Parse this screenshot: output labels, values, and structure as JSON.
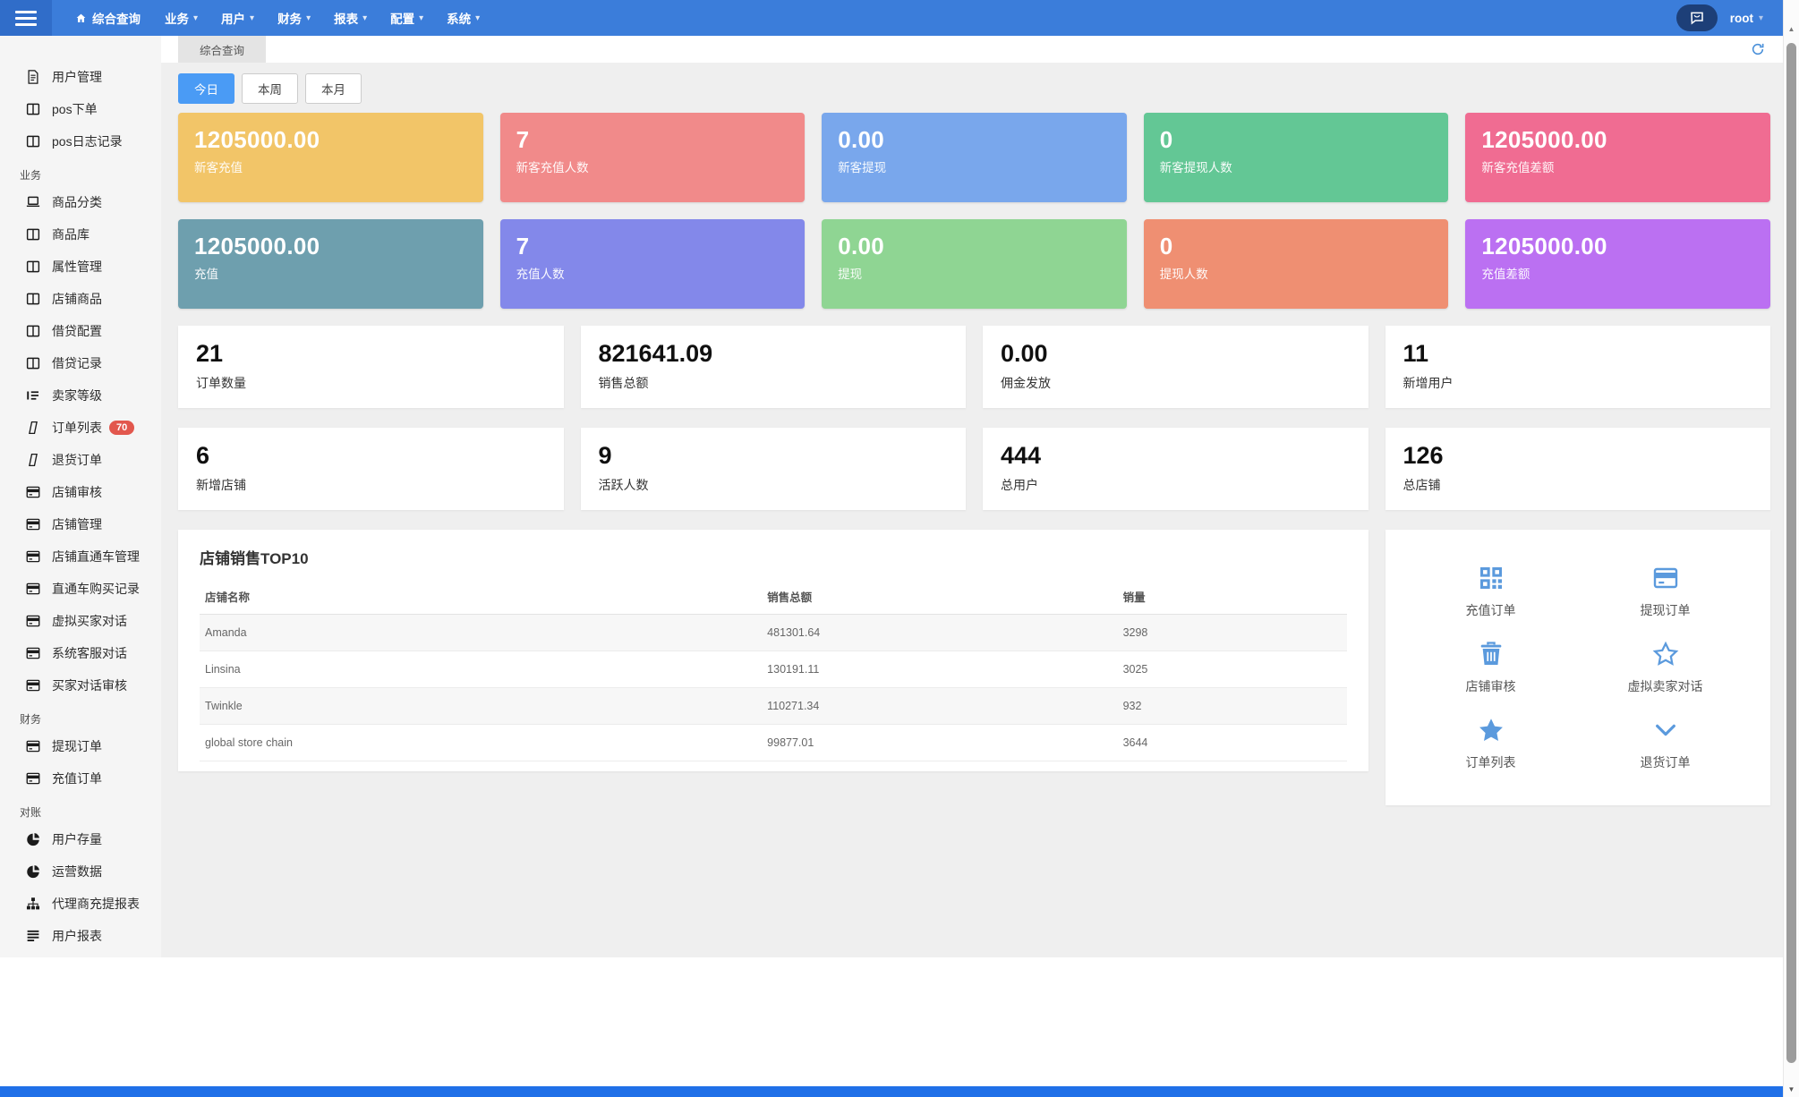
{
  "navbar": {
    "brand": "综合查询",
    "menus": [
      "业务",
      "用户",
      "财务",
      "报表",
      "配置",
      "系统"
    ],
    "user": "root"
  },
  "tabbar": {
    "active_tab": "综合查询"
  },
  "filters": {
    "today": "今日",
    "week": "本周",
    "month": "本月"
  },
  "sidebar": {
    "sections": [
      {
        "header": "",
        "items": [
          {
            "icon": "file-text",
            "label": "用户管理"
          },
          {
            "icon": "columns",
            "label": "pos下单"
          },
          {
            "icon": "columns",
            "label": "pos日志记录"
          }
        ]
      },
      {
        "header": "业务",
        "items": [
          {
            "icon": "laptop",
            "label": "商品分类"
          },
          {
            "icon": "columns",
            "label": "商品库"
          },
          {
            "icon": "columns",
            "label": "属性管理"
          },
          {
            "icon": "columns",
            "label": "店铺商品"
          },
          {
            "icon": "columns",
            "label": "借贷配置"
          },
          {
            "icon": "columns",
            "label": "借贷记录"
          },
          {
            "icon": "list",
            "label": "卖家等级"
          },
          {
            "icon": "order",
            "label": "订单列表",
            "badge": "70"
          },
          {
            "icon": "order",
            "label": "退货订单"
          },
          {
            "icon": "credit-card",
            "label": "店铺审核"
          },
          {
            "icon": "credit-card",
            "label": "店铺管理"
          },
          {
            "icon": "credit-card",
            "label": "店铺直通车管理"
          },
          {
            "icon": "credit-card",
            "label": "直通车购买记录"
          },
          {
            "icon": "credit-card",
            "label": "虚拟买家对话"
          },
          {
            "icon": "credit-card",
            "label": "系统客服对话"
          },
          {
            "icon": "credit-card",
            "label": "买家对话审核"
          }
        ]
      },
      {
        "header": "财务",
        "items": [
          {
            "icon": "credit-card",
            "label": "提现订单"
          },
          {
            "icon": "credit-card",
            "label": "充值订单"
          }
        ]
      },
      {
        "header": "对账",
        "items": [
          {
            "icon": "pie-chart",
            "label": "用户存量"
          },
          {
            "icon": "pie-chart",
            "label": "运营数据"
          },
          {
            "icon": "sitemap",
            "label": "代理商充提报表"
          },
          {
            "icon": "lines",
            "label": "用户报表"
          }
        ]
      }
    ]
  },
  "stat_cards": {
    "row1": [
      {
        "value": "1205000.00",
        "label": "新客充值",
        "color": "#f2c568"
      },
      {
        "value": "7",
        "label": "新客充值人数",
        "color": "#f18a8a"
      },
      {
        "value": "0.00",
        "label": "新客提现",
        "color": "#79a7ec"
      },
      {
        "value": "0",
        "label": "新客提现人数",
        "color": "#63c795"
      },
      {
        "value": "1205000.00",
        "label": "新客充值差额",
        "color": "#f06c92"
      }
    ],
    "row2": [
      {
        "value": "1205000.00",
        "label": "充值",
        "color": "#6e9fae"
      },
      {
        "value": "7",
        "label": "充值人数",
        "color": "#8388ea"
      },
      {
        "value": "0.00",
        "label": "提现",
        "color": "#8fd593"
      },
      {
        "value": "0",
        "label": "提现人数",
        "color": "#ef8f72"
      },
      {
        "value": "1205000.00",
        "label": "充值差额",
        "color": "#bb70f2"
      }
    ]
  },
  "summary_cards": {
    "row1": [
      {
        "value": "21",
        "label": "订单数量"
      },
      {
        "value": "821641.09",
        "label": "销售总额"
      },
      {
        "value": "0.00",
        "label": "佣金发放"
      },
      {
        "value": "11",
        "label": "新增用户"
      }
    ],
    "row2": [
      {
        "value": "6",
        "label": "新增店铺"
      },
      {
        "value": "9",
        "label": "活跃人数"
      },
      {
        "value": "444",
        "label": "总用户"
      },
      {
        "value": "126",
        "label": "总店铺"
      }
    ]
  },
  "table": {
    "title": "店铺销售TOP10",
    "headers": [
      "店铺名称",
      "销售总额",
      "销量"
    ],
    "rows": [
      [
        "Amanda",
        "481301.64",
        "3298"
      ],
      [
        "Linsina",
        "130191.11",
        "3025"
      ],
      [
        "Twinkle",
        "110271.34",
        "932"
      ],
      [
        "global store chain",
        "99877.01",
        "3644"
      ]
    ]
  },
  "quick_actions": [
    {
      "icon": "qrcode",
      "label": "充值订单"
    },
    {
      "icon": "credit-card",
      "label": "提现订单"
    },
    {
      "icon": "trash",
      "label": "店铺审核"
    },
    {
      "icon": "star-outline",
      "label": "虚拟卖家对话"
    },
    {
      "icon": "star",
      "label": "订单列表"
    },
    {
      "icon": "chevron-down",
      "label": "退货订单"
    }
  ],
  "colors": {
    "navbar": "#3b7dda",
    "navbar_dark": "#306dc9",
    "chat_pill": "#1d3f78",
    "footer": "#2070e8",
    "active_filter": "#4a9bf5",
    "badge": "#e2574d",
    "quick_icon": "#5b9add",
    "content_bg": "#efefef"
  }
}
